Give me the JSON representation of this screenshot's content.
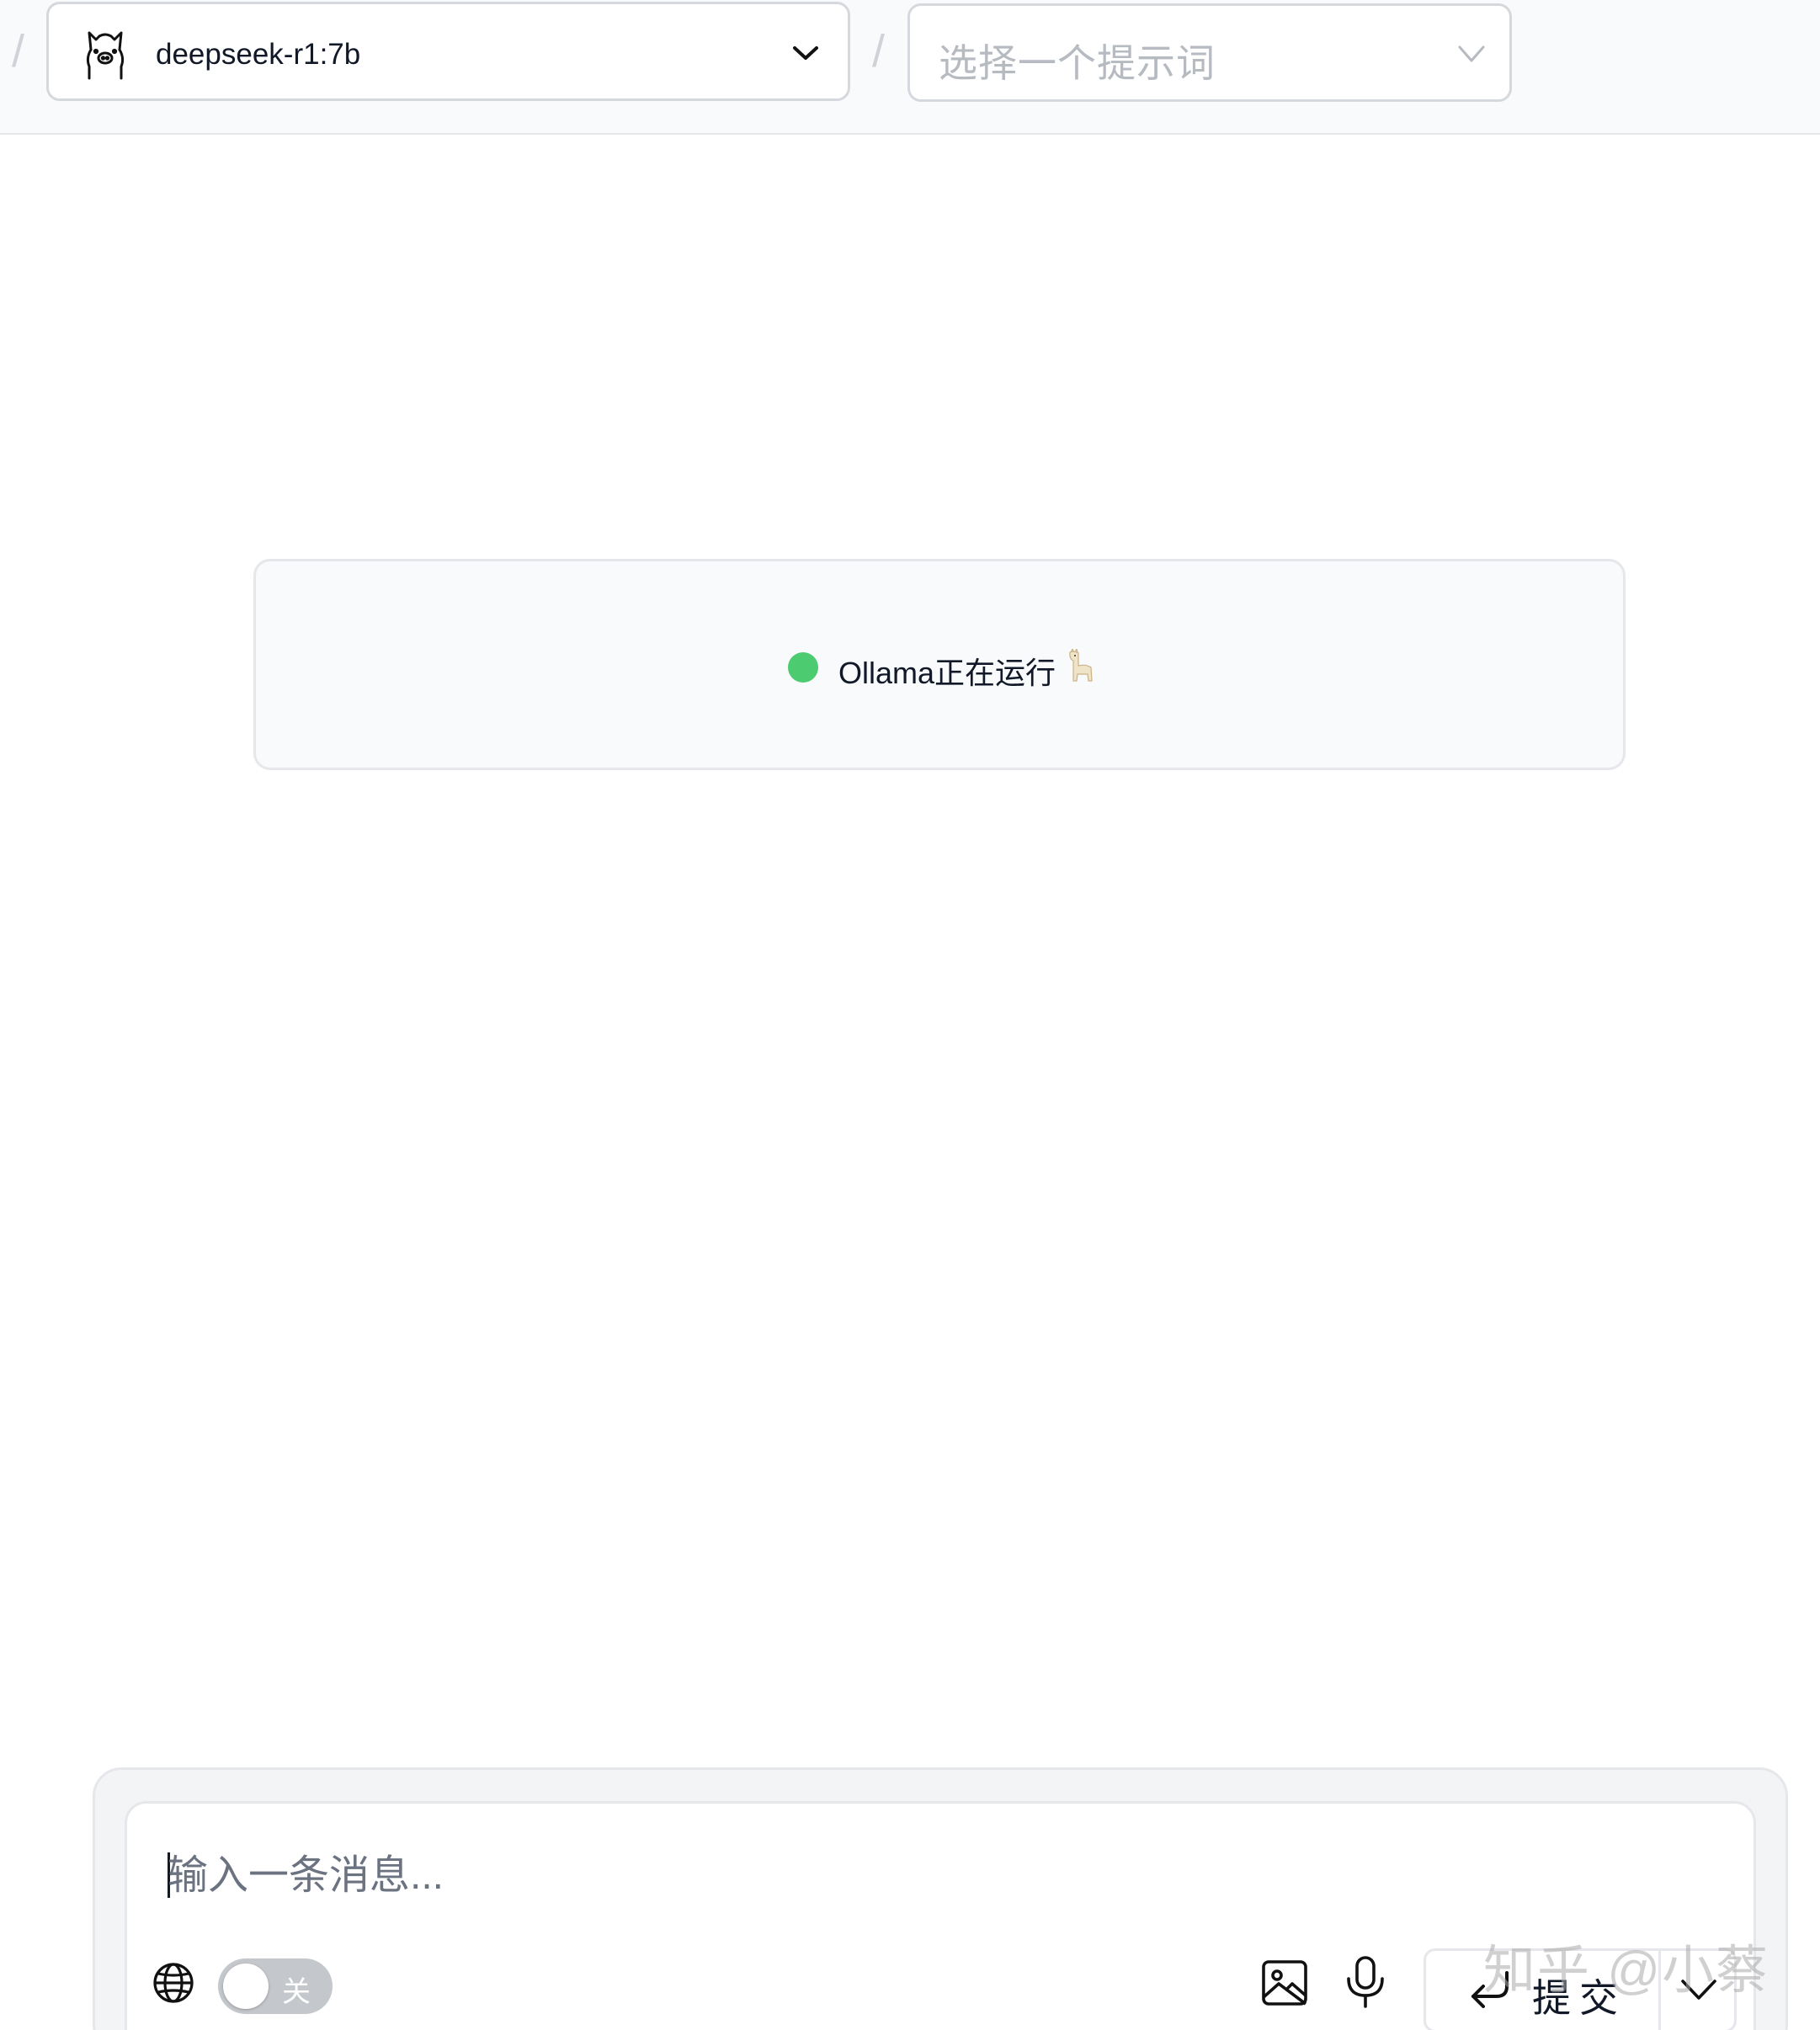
{
  "header": {
    "separator": "/",
    "model_select": {
      "value": "deepseek-r1:7b",
      "icon": "llama-icon"
    },
    "prompt_select": {
      "placeholder": "选择一个提示词",
      "icon": "chevron-down-icon"
    }
  },
  "status": {
    "text": "Ollama正在运行",
    "dot_color": "#4ccb71",
    "emoji_icon": "llama-emoji-icon"
  },
  "composer": {
    "placeholder": "输入一条消息...",
    "web_search_icon": "globe-icon",
    "toggle": {
      "label": "关",
      "state": "off"
    },
    "image_icon": "image-icon",
    "mic_icon": "microphone-icon",
    "submit_label": "提交",
    "submit_icon": "enter-icon",
    "more_icon": "chevron-down-icon"
  },
  "watermark": "知乎 @小蔡"
}
